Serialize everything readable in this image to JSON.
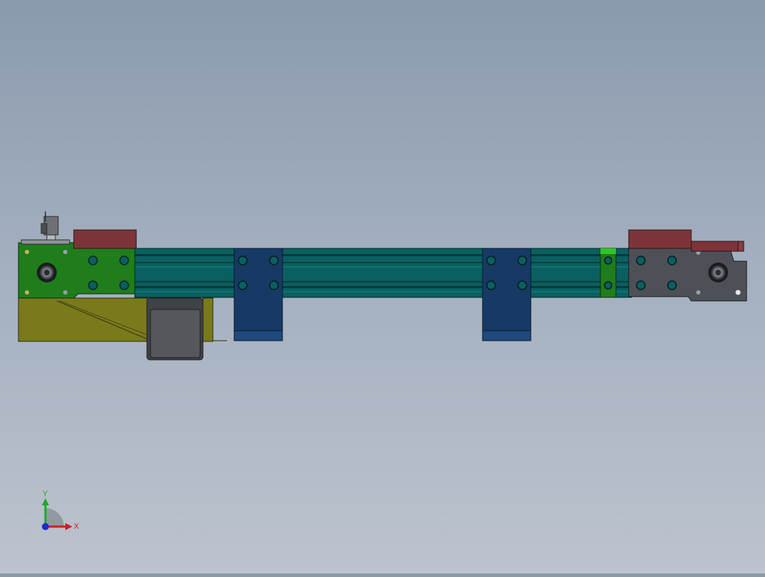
{
  "triad": {
    "x_label": "X",
    "y_label": "Y",
    "x_color": "#cc1f1f",
    "y_color": "#1fa82c",
    "z_color": "#1f2fcc"
  },
  "colors": {
    "rail": "#0b5f60",
    "rail_groove": "#063d40",
    "green_plate": "#1f7d1c",
    "grey_plate": "#4d5157",
    "blue_bracket": "#173a64",
    "olive_base": "#7a7a1c",
    "maroon_block": "#7d3438",
    "motor": "#54575c",
    "bolt_ring": "#2a9aa0"
  },
  "icons": {
    "triad": "coordinate-triad-icon"
  }
}
